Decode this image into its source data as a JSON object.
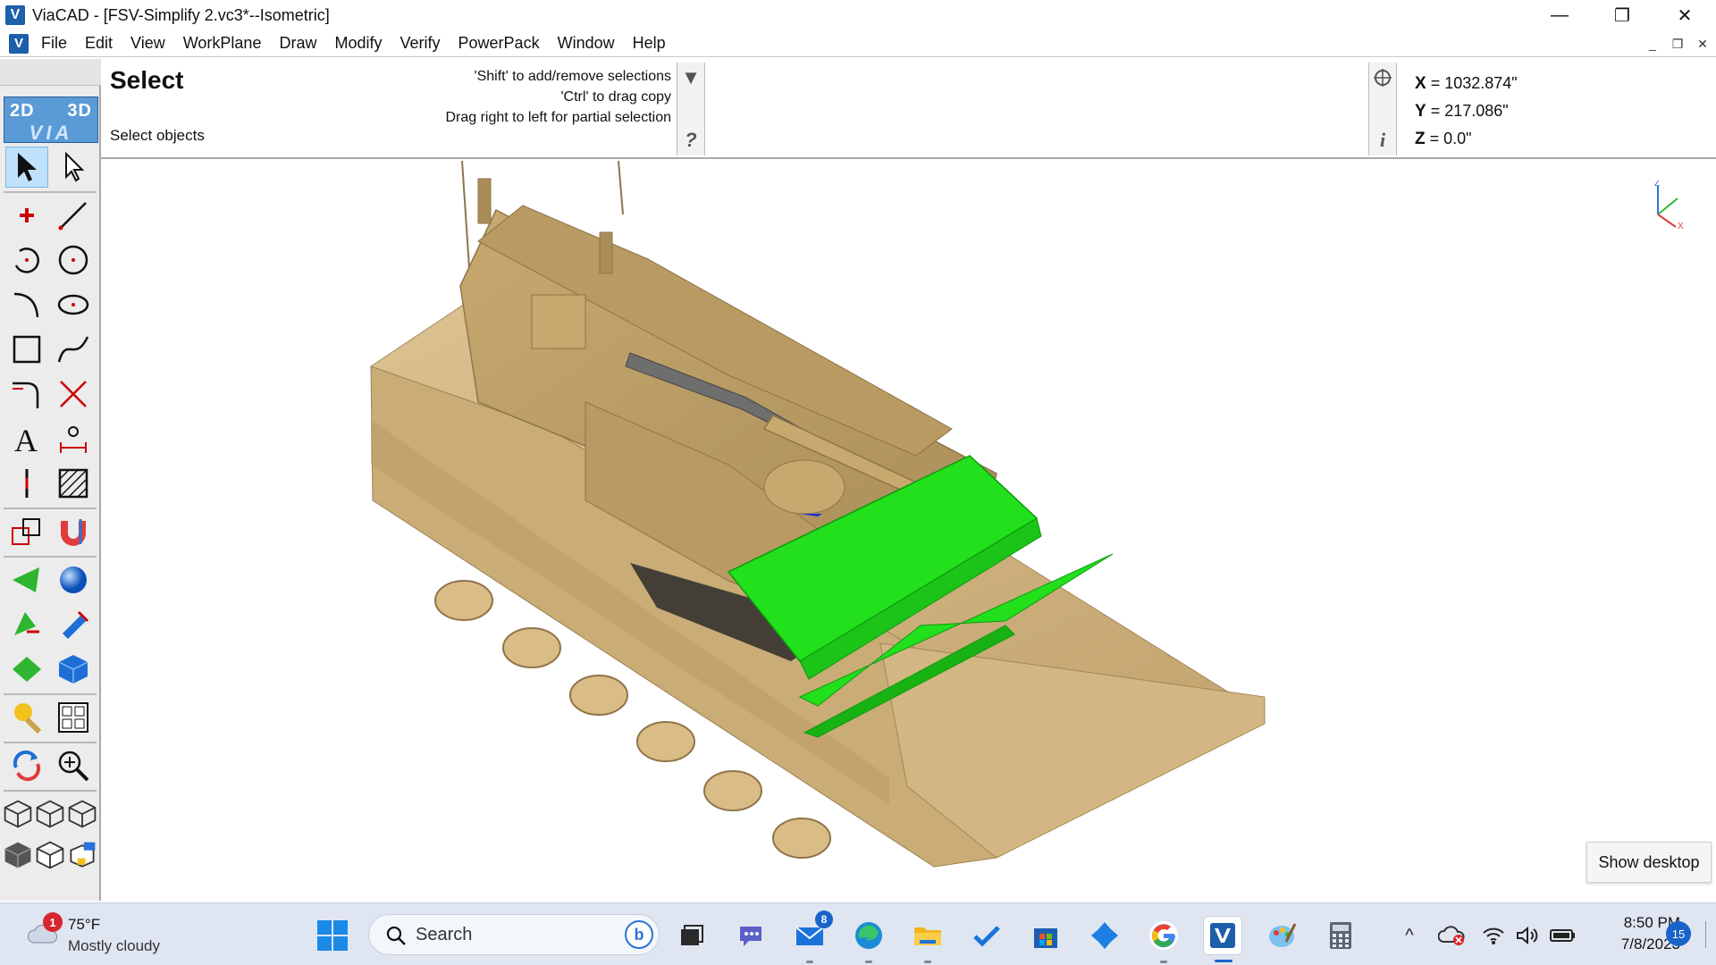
{
  "window": {
    "title": "ViaCAD - [FSV-Simplify 2.vc3*--Isometric]",
    "logo_letter": "V",
    "minimize": "—",
    "maximize": "❐",
    "close": "✕"
  },
  "menu": {
    "items": [
      "File",
      "Edit",
      "View",
      "WorkPlane",
      "Draw",
      "Modify",
      "Verify",
      "PowerPack",
      "Window",
      "Help"
    ],
    "mdi_minimize": "_",
    "mdi_restore": "❐",
    "mdi_close": "✕"
  },
  "toolbar": {
    "logo_2d": "2D",
    "logo_3d": "3D",
    "logo_via": "VIA"
  },
  "prompt": {
    "title": "Select",
    "subtitle": "Select objects",
    "hints": [
      "'Shift' to add/remove selections",
      "'Ctrl' to drag copy",
      "Drag right to left for partial selection"
    ],
    "dropdown_glyph": "▼",
    "help_glyph": "?",
    "info_glyph": "i"
  },
  "coordinates": {
    "x_label": "X",
    "x_value": "= 1032.874\"",
    "y_label": "Y",
    "y_value": "= 217.086\"",
    "z_label": "Z",
    "z_value": "= 0.0\""
  },
  "axis_triad": {
    "z": "Z",
    "x": "X"
  },
  "show_desktop": "Show desktop",
  "colors": {
    "model_tan": "#c9ad7a",
    "selected_green": "#22e01c",
    "accent_blue": "#1a63c9"
  },
  "taskbar": {
    "weather": {
      "badge": "1",
      "temperature": "75°F",
      "condition": "Mostly cloudy"
    },
    "search_label": "Search",
    "apps": [
      {
        "name": "task-view-icon"
      },
      {
        "name": "teams-icon"
      },
      {
        "name": "mail-icon",
        "badge": "8"
      },
      {
        "name": "edge-icon"
      },
      {
        "name": "file-explorer-icon"
      },
      {
        "name": "todo-icon"
      },
      {
        "name": "store-icon"
      },
      {
        "name": "copilot-icon"
      },
      {
        "name": "google-icon"
      },
      {
        "name": "viacad-icon"
      },
      {
        "name": "paint-icon"
      },
      {
        "name": "calculator-icon"
      }
    ],
    "clock": {
      "time": "8:50 PM",
      "date": "7/8/2023"
    },
    "notification_count": "15"
  }
}
